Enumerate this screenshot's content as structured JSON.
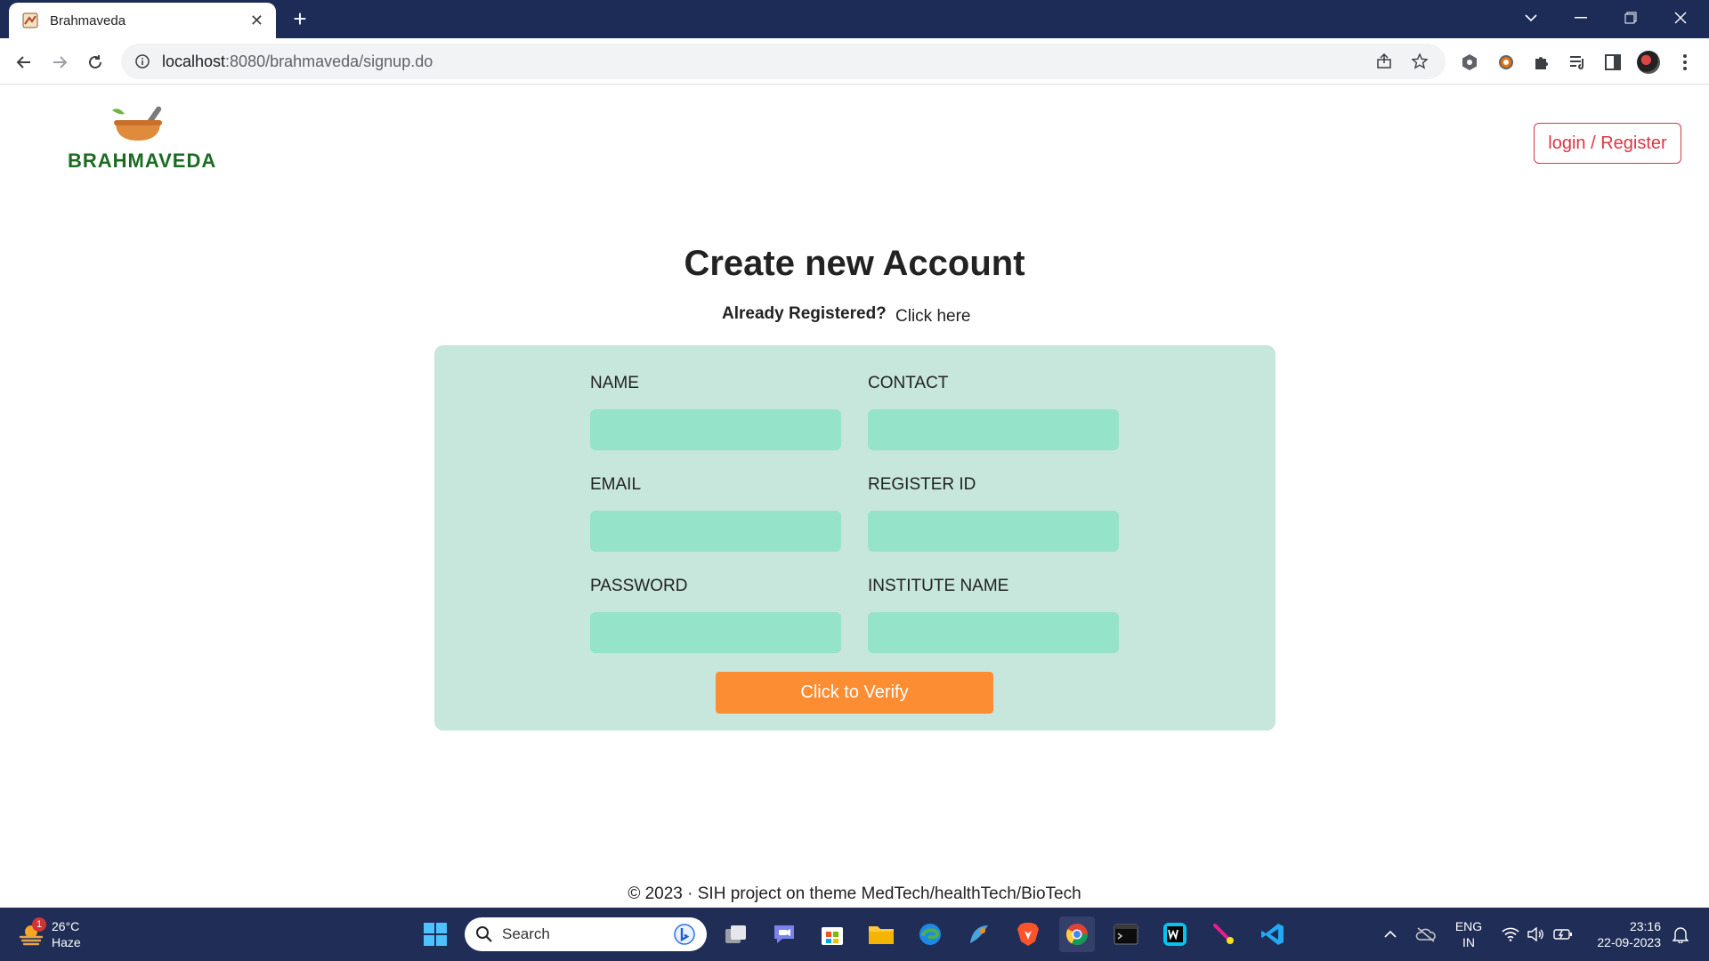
{
  "browser": {
    "tab_title": "Brahmaveda",
    "url_host": "localhost",
    "url_path": ":8080/brahmaveda/signup.do"
  },
  "header": {
    "logo_text": "BRAHMAVEDA",
    "login_label": "login / Register"
  },
  "main": {
    "title": "Create new Account",
    "already_registered": "Already Registered?",
    "click_here": "Click here"
  },
  "form": {
    "fields": [
      {
        "label": "NAME",
        "value": ""
      },
      {
        "label": "CONTACT",
        "value": ""
      },
      {
        "label": "EMAIL",
        "value": ""
      },
      {
        "label": "REGISTER ID",
        "value": ""
      },
      {
        "label": "PASSWORD",
        "value": ""
      },
      {
        "label": "INSTITUTE NAME",
        "value": ""
      }
    ],
    "submit_label": "Click to Verify"
  },
  "footer": {
    "text": "© 2023 · SIH project on theme MedTech/healthTech/BioTech"
  },
  "taskbar": {
    "weather_temp": "26°C",
    "weather_desc": "Haze",
    "weather_badge": "1",
    "search_placeholder": "Search",
    "lang_line1": "ENG",
    "lang_line2": "IN",
    "time": "23:16",
    "date": "22-09-2023"
  },
  "colors": {
    "accent_button": "#fd8d33",
    "form_bg": "#c7e6dc",
    "input_bg": "#95e3c8",
    "login_border": "#dc3545",
    "logo_green": "#1b6b22"
  }
}
